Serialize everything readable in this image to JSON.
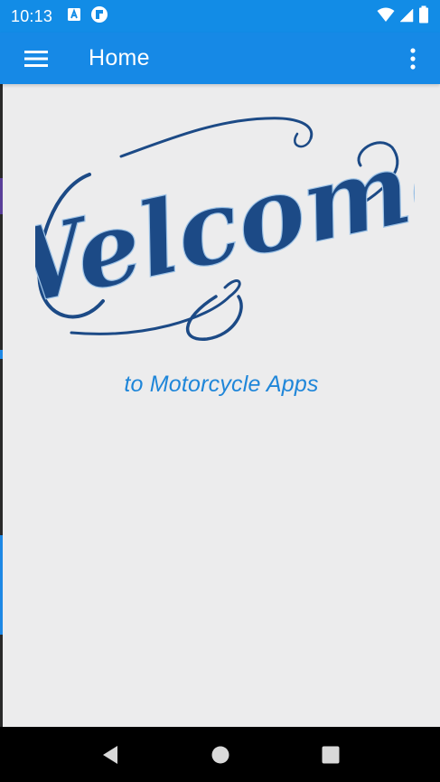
{
  "status_bar": {
    "time": "10:13",
    "icons": [
      "autofill-a-icon",
      "flipboard-icon",
      "wifi-icon",
      "signal-icon",
      "battery-icon"
    ]
  },
  "app_bar": {
    "title": "Home",
    "menu_icon": "hamburger-menu-icon",
    "overflow_icon": "more-vert-icon"
  },
  "content": {
    "welcome_text": "Welcome",
    "subtitle": "to Motorcycle Apps"
  },
  "nav_bar": {
    "icons": [
      "back-icon",
      "home-icon",
      "recents-icon"
    ]
  },
  "colors": {
    "primary": "#1689e6",
    "status_bar": "#128ce6",
    "background": "#ececed",
    "welcome_navy": "#1c4a86",
    "subtitle_blue": "#1f86d9"
  }
}
